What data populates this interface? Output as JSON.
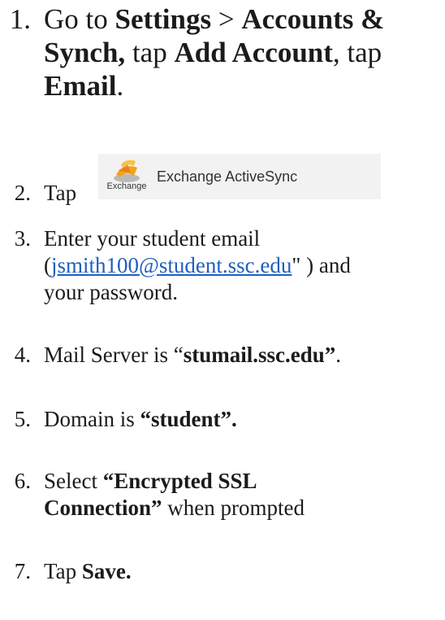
{
  "steps": [
    {
      "number": "1.",
      "t1": "Go to ",
      "b1": "Settings",
      "t2": " > ",
      "b2": "Accounts &",
      "b3": "Synch,",
      "t3": " tap ",
      "b4": "Add Account",
      "t4": ", tap",
      "b5": "Email",
      "t5": "."
    },
    {
      "number": "2.",
      "text": "Tap",
      "image": {
        "logo_text": "Exchange",
        "label": "Exchange ActiveSync",
        "icon": "exchange-logo-icon"
      }
    },
    {
      "number": "3.",
      "line1": "Enter your student email",
      "open": "(",
      "link": "jsmith100@student.ssc.edu",
      "close": "\" ) and",
      "line3": "your password."
    },
    {
      "number": "4.",
      "t1": "Mail Server is “",
      "b1": "stumail.ssc.edu”",
      "t2": "."
    },
    {
      "number": "5.",
      "t1": "Domain is ",
      "b1": "“student”."
    },
    {
      "number": "6.",
      "t1": "Select ",
      "b1": "“Encrypted SSL",
      "b2": "Connection”",
      "t2": " when prompted"
    },
    {
      "number": "7.",
      "t1": "Tap ",
      "b1": "Save."
    }
  ],
  "colors": {
    "text": "#1b1b1b",
    "link": "#1f5fbf",
    "image_bg": "#f2f2f2"
  }
}
